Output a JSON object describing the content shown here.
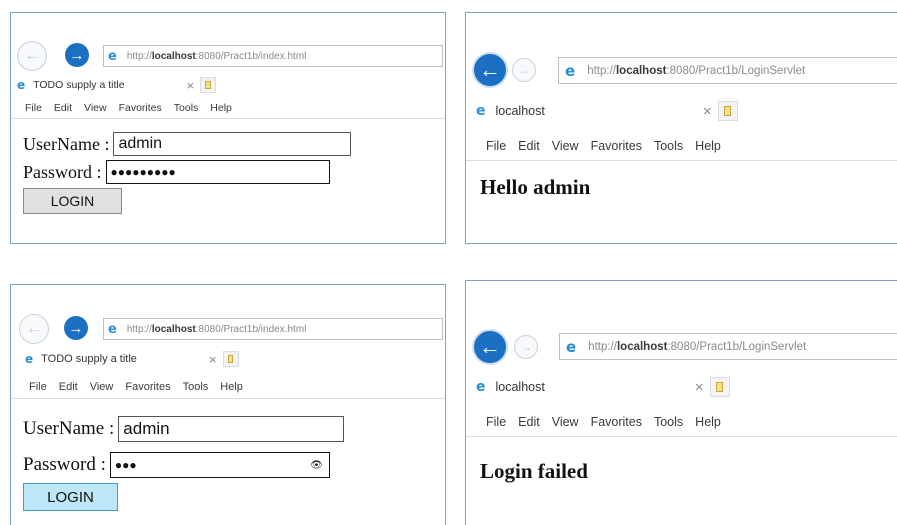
{
  "windows": [
    {
      "url_prefix": "http://",
      "url_host": "localhost",
      "url_rest": ":8080/Pract1b/index.html",
      "tab_title": "TODO supply a title",
      "tab_close": "×",
      "menu": [
        "File",
        "Edit",
        "View",
        "Favorites",
        "Tools",
        "Help"
      ],
      "username_label": "UserName :",
      "username_value": "admin",
      "password_label": "Password :",
      "password_value": "●●●●●●●●●",
      "login_label": "LOGIN"
    },
    {
      "url_prefix": "http://",
      "url_host": "localhost",
      "url_rest": ":8080/Pract1b/LoginServlet",
      "tab_title": "localhost",
      "tab_close": "×",
      "menu": [
        "File",
        "Edit",
        "View",
        "Favorites",
        "Tools",
        "Help"
      ],
      "message": "Hello admin"
    },
    {
      "url_prefix": "http://",
      "url_host": "localhost",
      "url_rest": ":8080/Pract1b/index.html",
      "tab_title": "TODO supply a title",
      "tab_close": "×",
      "menu": [
        "File",
        "Edit",
        "View",
        "Favorites",
        "Tools",
        "Help"
      ],
      "username_label": "UserName :",
      "username_value": "admin",
      "password_label": "Password :",
      "password_value": "●●●",
      "reveal_icon": "👁",
      "login_label": "LOGIN"
    },
    {
      "url_prefix": "http://",
      "url_host": "localhost",
      "url_rest": ":8080/Pract1b/LoginServlet",
      "tab_title": "localhost",
      "tab_close": "×",
      "menu": [
        "File",
        "Edit",
        "View",
        "Favorites",
        "Tools",
        "Help"
      ],
      "message": "Login failed"
    }
  ],
  "icons": {
    "back_arrow": "←",
    "forward_arrow": "→",
    "ie_logo": "e"
  },
  "colors": {
    "window_border": "#7fa4cc",
    "nav_blue": "#1b70c4",
    "focused_button": "#bde6f6"
  }
}
